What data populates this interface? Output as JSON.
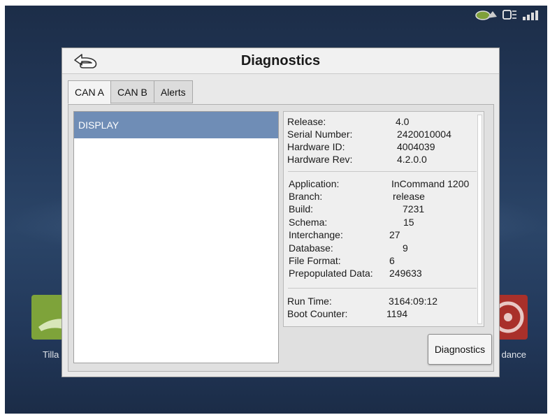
{
  "dialog": {
    "title": "Diagnostics"
  },
  "tabs": [
    {
      "label": "CAN A",
      "active": true
    },
    {
      "label": "CAN B",
      "active": false
    },
    {
      "label": "Alerts",
      "active": false
    }
  ],
  "devices": [
    {
      "label": "DISPLAY",
      "selected": true
    }
  ],
  "info": {
    "group1": [
      {
        "label": "Release:",
        "value": "4.0"
      },
      {
        "label": "Serial Number:",
        "value": "2420010004"
      },
      {
        "label": "Hardware ID:",
        "value": "4004039"
      },
      {
        "label": "Hardware Rev:",
        "value": "4.2.0.0"
      }
    ],
    "group2": [
      {
        "label": "Application:",
        "value": "InCommand 1200"
      },
      {
        "label": "Branch:",
        "value": "release"
      },
      {
        "label": "Build:",
        "value": "7231"
      },
      {
        "label": "Schema:",
        "value": "15"
      },
      {
        "label": "Interchange:",
        "value": "27"
      },
      {
        "label": "Database:",
        "value": "9"
      },
      {
        "label": "File Format:",
        "value": "6"
      },
      {
        "label": "Prepopulated Data:",
        "value": "249633"
      }
    ],
    "group3": [
      {
        "label": "Run Time:",
        "value": "3164:09:12"
      },
      {
        "label": "Boot Counter:",
        "value": "1194"
      }
    ]
  },
  "buttons": {
    "diagnostics": "Diagnostics"
  },
  "background_apps": {
    "left_label": "Tilla",
    "right_label": "dance"
  },
  "colors": {
    "selection": "#6f8db6",
    "background": "#23395a"
  }
}
